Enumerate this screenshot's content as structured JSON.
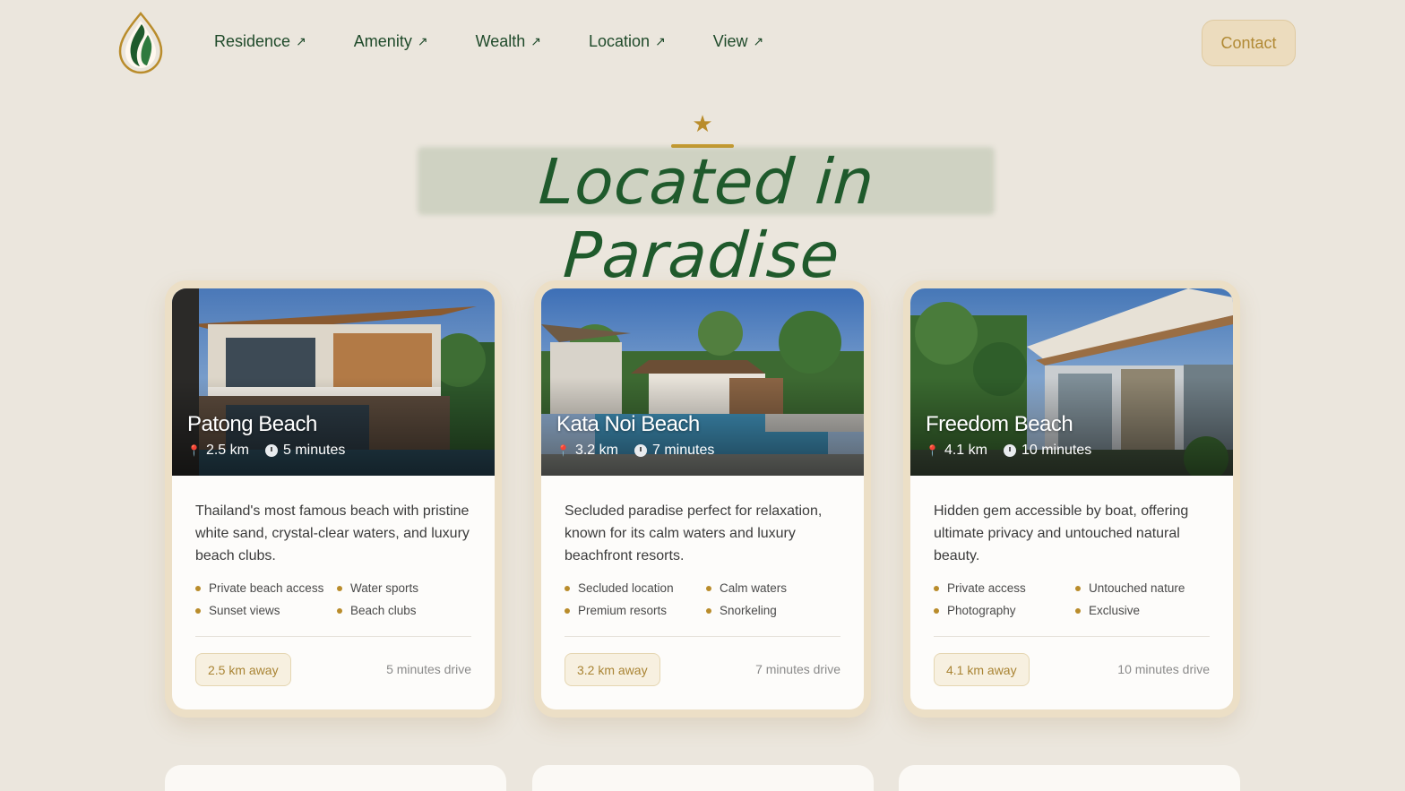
{
  "nav": {
    "logo": "leaf-logo",
    "links": [
      {
        "label": "Residence",
        "icon": "arrow-up-right-icon"
      },
      {
        "label": "Amenity",
        "icon": "arrow-up-right-icon"
      },
      {
        "label": "Wealth",
        "icon": "arrow-up-right-icon"
      },
      {
        "label": "Location",
        "icon": "arrow-up-right-icon"
      },
      {
        "label": "View",
        "icon": "arrow-up-right-icon"
      }
    ],
    "contact_label": "Contact"
  },
  "hero": {
    "title": "Located in Paradise",
    "icon": "star-icon"
  },
  "colors": {
    "background": "#ebe6dd",
    "primary_green": "#1f4a2a",
    "gold_accent": "#b98c2b"
  },
  "cards": [
    {
      "name": "Patong Beach",
      "distance": "2.5 km",
      "time": "5 minutes",
      "description": "Thailand's most famous beach with pristine white sand, crystal-clear waters, and luxury beach clubs.",
      "features": [
        "Private beach access",
        "Water sports",
        "Sunset views",
        "Beach clubs"
      ],
      "away": "2.5 km away",
      "drive": "5 minutes drive"
    },
    {
      "name": "Kata Noi Beach",
      "distance": "3.2 km",
      "time": "7 minutes",
      "description": "Secluded paradise perfect for relaxation, known for its calm waters and luxury beachfront resorts.",
      "features": [
        "Secluded location",
        "Calm waters",
        "Premium resorts",
        "Snorkeling"
      ],
      "away": "3.2 km away",
      "drive": "7 minutes drive"
    },
    {
      "name": "Freedom Beach",
      "distance": "4.1 km",
      "time": "10 minutes",
      "description": "Hidden gem accessible by boat, offering ultimate privacy and untouched natural beauty.",
      "features": [
        "Private access",
        "Untouched nature",
        "Photography",
        "Exclusive"
      ],
      "away": "4.1 km away",
      "drive": "10 minutes drive"
    }
  ]
}
